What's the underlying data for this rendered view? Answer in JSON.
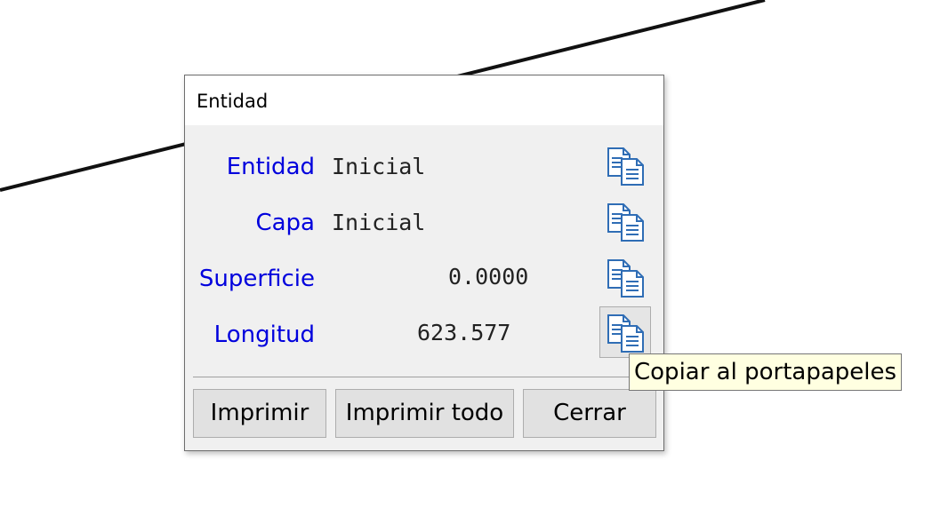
{
  "dialog": {
    "title": "Entidad"
  },
  "rows": [
    {
      "label": "Entidad",
      "value": "Inicial"
    },
    {
      "label": "Capa",
      "value": "Inicial"
    },
    {
      "label": "Superficie",
      "value": "0.0000"
    },
    {
      "label": "Longitud",
      "value": "623.577"
    }
  ],
  "copy_icon": "copy-to-clipboard-icon",
  "buttons": {
    "print": "Imprimir",
    "print_all": "Imprimir todo",
    "close": "Cerrar"
  },
  "tooltip": "Copiar al portapapeles",
  "colors": {
    "label": "#0000dd",
    "icon": "#2f6db5",
    "tooltip_bg": "#ffffe1"
  }
}
